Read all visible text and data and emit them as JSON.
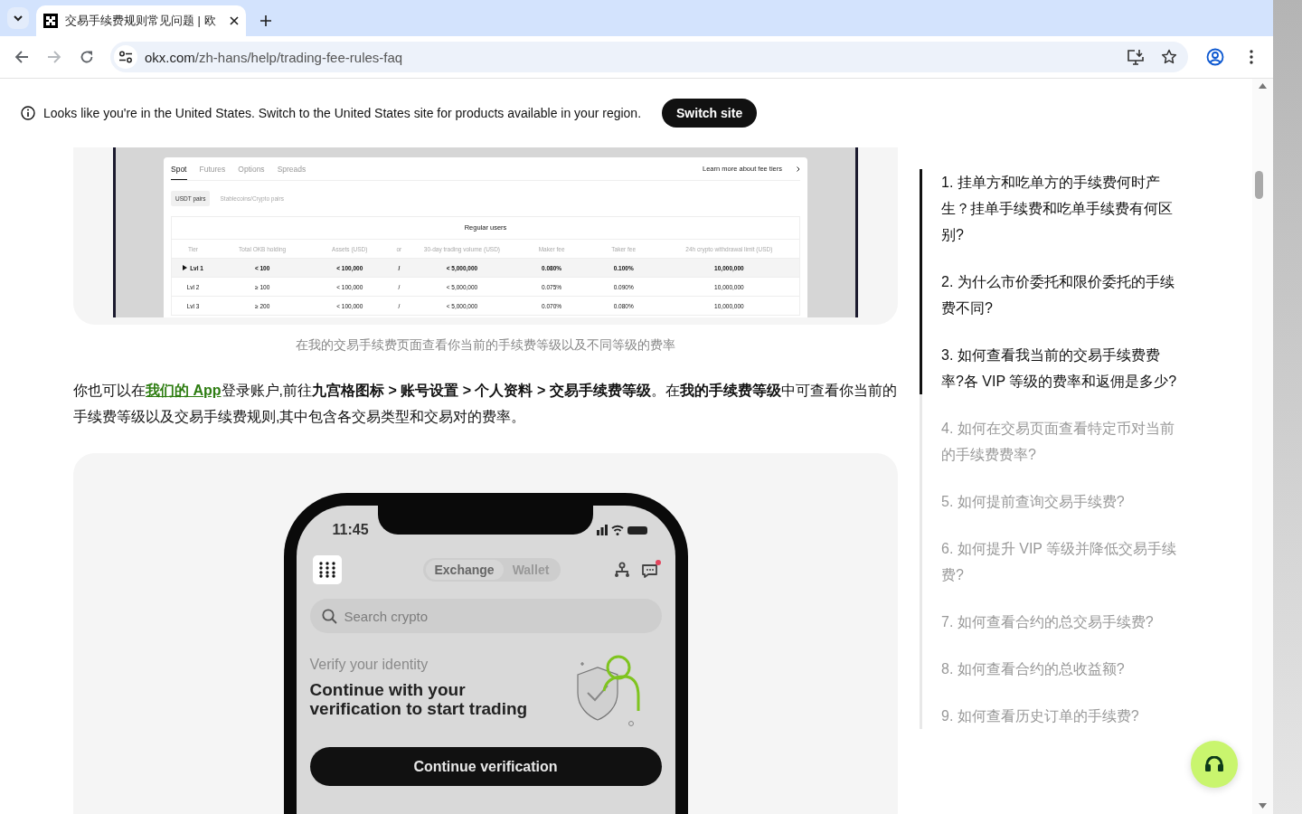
{
  "browser": {
    "tab": {
      "title": "交易手续费规则常见问题 | 欧",
      "selected": true
    },
    "address": {
      "domain": "okx.com",
      "path": "/zh-hans/help/trading-fee-rules-faq"
    },
    "forward_disabled": true
  },
  "banner": {
    "message": "Looks like you're in the United States. Switch to the United States site for products available in your region.",
    "button": "Switch site"
  },
  "fee_screenshot": {
    "tabs": [
      {
        "label": "Spot",
        "selected": true
      },
      {
        "label": "Futures",
        "selected": false
      },
      {
        "label": "Options",
        "selected": false
      },
      {
        "label": "Spreads",
        "selected": false
      }
    ],
    "link": "Learn more about fee tiers",
    "pair_tabs": [
      {
        "label": "USDT pairs",
        "selected": true
      },
      {
        "label": "Stablecoins/Crypto pairs",
        "selected": false
      }
    ],
    "table_title": "Regular users",
    "columns": [
      "Tier",
      "Total OKB holding",
      "Assets (USD)",
      "or",
      "30-day trading volume (USD)",
      "Maker fee",
      "Taker fee",
      "24h crypto withdrawal limit (USD)"
    ],
    "rows": [
      {
        "selected": true,
        "cells": [
          "Lvl 1",
          "< 100",
          "< 100,000",
          "/",
          "< 5,000,000",
          "0.080%",
          "0.100%",
          "10,000,000"
        ]
      },
      {
        "selected": false,
        "cells": [
          "Lvl 2",
          "≥ 100",
          "< 100,000",
          "/",
          "< 5,000,000",
          "0.075%",
          "0.090%",
          "10,000,000"
        ]
      },
      {
        "selected": false,
        "cells": [
          "Lvl 3",
          "≥ 200",
          "< 100,000",
          "/",
          "< 5,000,000",
          "0.070%",
          "0.080%",
          "10,000,000"
        ]
      }
    ]
  },
  "caption": "在我的交易手续费页面查看你当前的手续费等级以及不同等级的费率",
  "paragraph": {
    "before": "你也可以在",
    "link": "我们的 App",
    "after": "登录账户,前往**九宫格图标 > 账号设置 > 个人资料 > 交易手续费等级**。在**我的手续费等级**中可查看你当前的手续费等级以及交易手续费规则,其中包含各交易类型和交易对的费率。"
  },
  "phone_screenshot": {
    "time": "11:45",
    "segments": [
      {
        "label": "Exchange",
        "selected": true
      },
      {
        "label": "Wallet",
        "selected": false
      }
    ],
    "search_placeholder": "Search crypto",
    "has_notification": true,
    "eyebrow": "Verify your identity",
    "headline": "Continue with your verification to start trading",
    "button": "Continue verification"
  },
  "toc": {
    "items": [
      {
        "label": "1. 挂单方和吃单方的手续费何时产生？挂单手续费和吃单手续费有何区别?",
        "active": true
      },
      {
        "label": "2. 为什么市价委托和限价委托的手续费不同?",
        "active": true
      },
      {
        "label": "3. 如何查看我当前的交易手续费费率?各 VIP 等级的费率和返佣是多少?",
        "active": true
      },
      {
        "label": "4. 如何在交易页面查看特定币对当前的手续费费率?",
        "active": false
      },
      {
        "label": "5. 如何提前查询交易手续费?",
        "active": false
      },
      {
        "label": "6. 如何提升 VIP 等级并降低交易手续费?",
        "active": false
      },
      {
        "label": "7. 如何查看合约的总交易手续费?",
        "active": false
      },
      {
        "label": "8. 如何查看合约的总收益额?",
        "active": false
      },
      {
        "label": "9. 如何查看历史订单的手续费?",
        "active": false
      }
    ]
  }
}
